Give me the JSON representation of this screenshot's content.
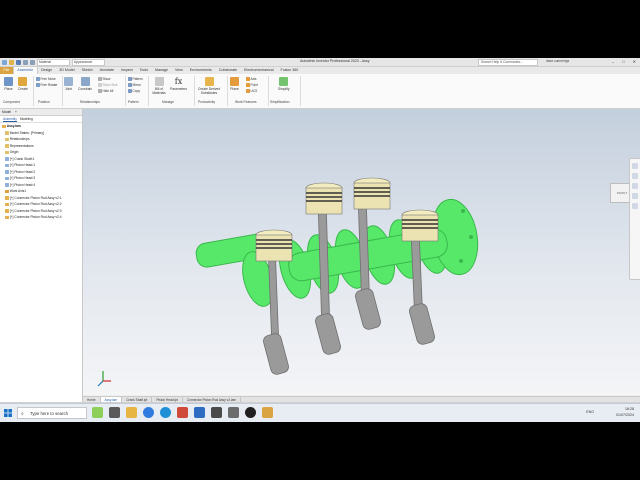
{
  "app": {
    "title": "Autodesk Inventor Professional 2023 - Assy",
    "material": "Material",
    "appearance": "Appearance",
    "search_placeholder": "Search Help & Commands...",
    "user": "dave.cummings"
  },
  "ribbon_tabs": [
    "File",
    "Assemble",
    "Design",
    "3D Model",
    "Sketch",
    "Annotate",
    "Inspect",
    "Tools",
    "Manage",
    "View",
    "Environments",
    "Collaborate",
    "Electromechanical",
    "Fusion 360"
  ],
  "ribbon": {
    "place": "Place",
    "create": "Create",
    "free_move": "Free Move",
    "free_rotate": "Free Rotate",
    "joint": "Joint",
    "constrain": "Constrain",
    "show": "Show",
    "show_sick": "Show Sick",
    "hide_all": "Hide All",
    "pattern": "Pattern",
    "mirror": "Mirror",
    "copy": "Copy",
    "bill_of_materials": "Bill of Materials",
    "parameters": "Parameters",
    "create_derived": "Create Derived Substitutes",
    "plane": "Plane",
    "axis": "Axis",
    "point": "Point",
    "ucs": "UCS",
    "simplify": "Simplify",
    "groups": [
      "Component",
      "Position",
      "Relationships",
      "Pattern",
      "Manage",
      "Productivity",
      "Work Features",
      "Simplification"
    ]
  },
  "browser": {
    "header": "Model",
    "tabs": [
      "Assembly",
      "Modeling"
    ],
    "tree": [
      "Assy.iam",
      "Model States: [Primary]",
      "Relationships",
      "Representations",
      "Origin",
      "[+] Crank Shaft:1",
      "[+] Piston Head:1",
      "[+] Piston Head:2",
      "[+] Piston Head:3",
      "[+] Piston Head:4",
      "Work Axis1",
      "[+] Connector Piston Rod Assy v2:1",
      "[+] Connector Piston Rod Assy v2:2",
      "[+] Connector Piston Rod Assy v2:3",
      "[+] Connector Piston Rod Assy v2:4"
    ]
  },
  "viewport": {
    "viewcube_label": "FRONT"
  },
  "document_tabs": [
    "Home",
    "Assy.iam",
    "Crank Shaft.ipt",
    "Piston Head.ipt",
    "Connector Piston Rod Assy v2.iam"
  ],
  "active_document_tab": 1,
  "status": {
    "left": "Ready",
    "page": "37",
    "count": "6"
  },
  "taskbar": {
    "search": "Type here to search",
    "time": "18:28",
    "date": "01/07/2024",
    "lang": "ENG"
  },
  "colors": {
    "crank": "#57e86a",
    "rod": "#9a9a9a",
    "piston": "#ece3b2",
    "accent": "#2a5fa8",
    "file_tab": "#d9a441"
  }
}
